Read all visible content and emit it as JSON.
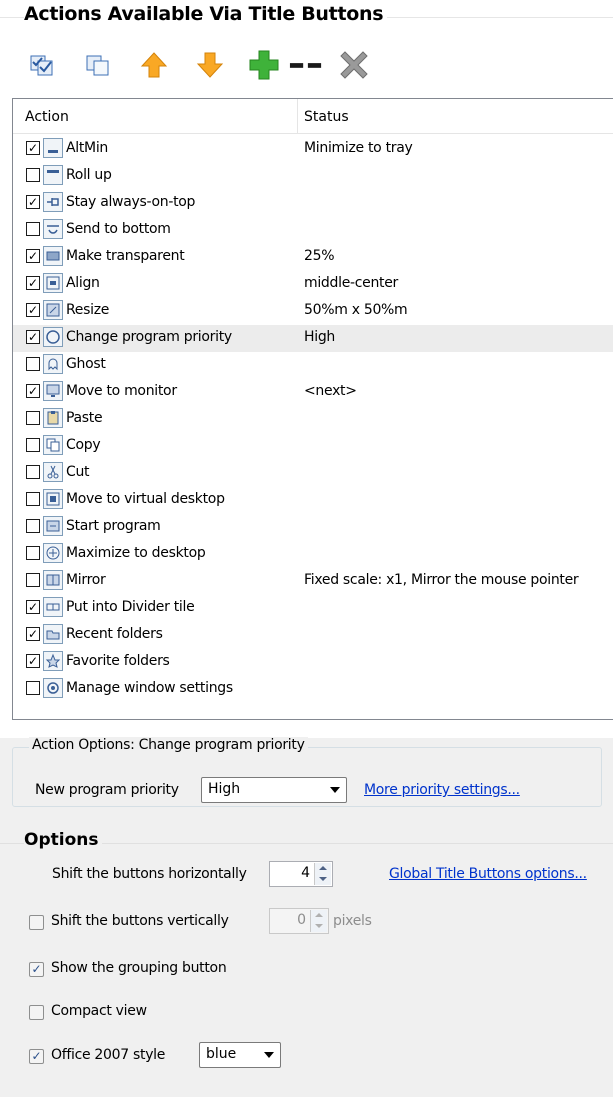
{
  "header": {
    "title": "Actions Available Via Title Buttons"
  },
  "toolbar": {
    "buttons": [
      {
        "icon": "check-all-icon"
      },
      {
        "icon": "uncheck-all-icon"
      },
      {
        "icon": "arrow-up-icon"
      },
      {
        "icon": "arrow-down-icon"
      },
      {
        "icon": "add-icon"
      },
      {
        "icon": "separator-icon"
      },
      {
        "icon": "delete-icon"
      }
    ]
  },
  "list": {
    "columns": {
      "action": "Action",
      "status": "Status"
    },
    "rows": [
      {
        "label": "AltMin",
        "status": "Minimize to tray",
        "checked": true,
        "icon": "altmin-icon"
      },
      {
        "label": "Roll up",
        "status": "",
        "checked": false,
        "icon": "roll-up-icon"
      },
      {
        "label": "Stay always-on-top",
        "status": "",
        "checked": true,
        "icon": "pin-icon"
      },
      {
        "label": "Send to bottom",
        "status": "",
        "checked": false,
        "icon": "send-to-bottom-icon"
      },
      {
        "label": "Make transparent",
        "status": "25%",
        "checked": true,
        "icon": "transparent-icon"
      },
      {
        "label": "Align",
        "status": "middle-center",
        "checked": true,
        "icon": "align-icon"
      },
      {
        "label": "Resize",
        "status": "50%m x 50%m",
        "checked": true,
        "icon": "resize-icon"
      },
      {
        "label": "Change program priority",
        "status": "High",
        "checked": true,
        "icon": "priority-icon",
        "selected": true
      },
      {
        "label": "Ghost",
        "status": "",
        "checked": false,
        "icon": "ghost-icon"
      },
      {
        "label": "Move to monitor",
        "status": "<next>",
        "checked": true,
        "icon": "monitor-icon"
      },
      {
        "label": "Paste",
        "status": "",
        "checked": false,
        "icon": "paste-icon"
      },
      {
        "label": "Copy",
        "status": "",
        "checked": false,
        "icon": "copy-icon"
      },
      {
        "label": "Cut",
        "status": "",
        "checked": false,
        "icon": "cut-icon"
      },
      {
        "label": "Move to virtual desktop",
        "status": "",
        "checked": false,
        "icon": "virtual-desktop-icon"
      },
      {
        "label": "Start program",
        "status": "",
        "checked": false,
        "icon": "start-program-icon"
      },
      {
        "label": "Maximize to desktop",
        "status": "",
        "checked": false,
        "icon": "maximize-icon"
      },
      {
        "label": "Mirror",
        "status": "Fixed scale: x1, Mirror the mouse pointer",
        "checked": false,
        "icon": "mirror-icon"
      },
      {
        "label": "Put into Divider tile",
        "status": "",
        "checked": true,
        "icon": "divider-icon"
      },
      {
        "label": "Recent folders",
        "status": "",
        "checked": true,
        "icon": "recent-folders-icon"
      },
      {
        "label": "Favorite folders",
        "status": "",
        "checked": true,
        "icon": "favorite-folders-icon"
      },
      {
        "label": "Manage window settings",
        "status": "",
        "checked": false,
        "icon": "settings-icon"
      }
    ]
  },
  "action_options": {
    "title": "Action Options: Change program priority",
    "priority_label": "New program priority",
    "priority_value": "High",
    "more_link": "More priority settings..."
  },
  "options": {
    "title": "Options",
    "shift_h_label": "Shift the buttons horizontally",
    "shift_h_value": "4",
    "global_link": "Global Title Buttons options...",
    "shift_v_label": "Shift the buttons vertically",
    "shift_v_value": "0",
    "shift_v_unit": "pixels",
    "shift_v_checked": false,
    "grouping_label": "Show the grouping button",
    "grouping_checked": true,
    "compact_label": "Compact view",
    "compact_checked": false,
    "office_label": "Office 2007 style",
    "office_checked": true,
    "office_value": "blue"
  },
  "colors": {
    "link": "#0033cc",
    "selected_row": "#ececec",
    "panel_bg": "#f0f0f0"
  }
}
